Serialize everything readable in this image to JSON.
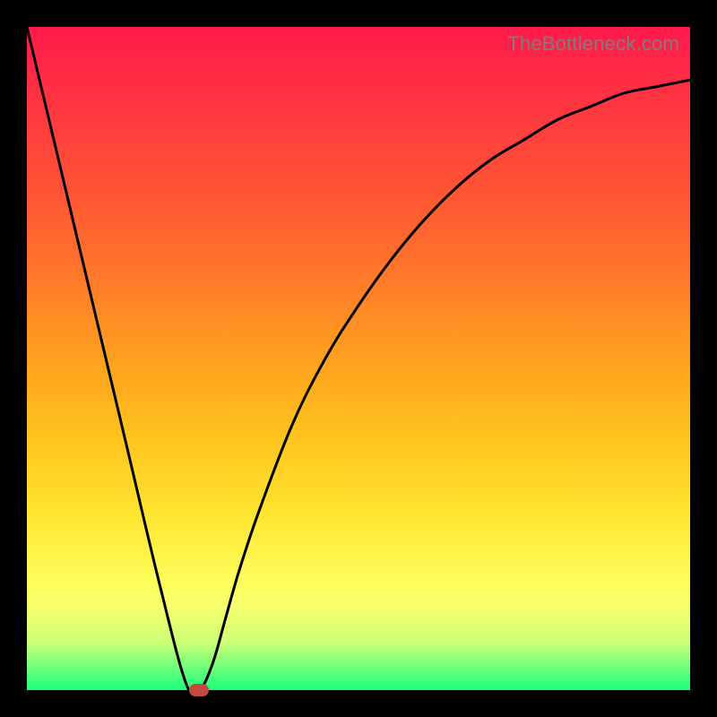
{
  "watermark": "TheBottleneck.com",
  "chart_data": {
    "type": "line",
    "title": "",
    "xlabel": "",
    "ylabel": "",
    "xlim": [
      0,
      100
    ],
    "ylim": [
      0,
      100
    ],
    "grid": false,
    "legend": false,
    "background": "red-yellow-green vertical gradient (high=red, low=green)",
    "series": [
      {
        "name": "bottleneck-curve",
        "x": [
          0,
          5,
          10,
          15,
          20,
          24,
          26,
          28,
          30,
          32,
          35,
          40,
          45,
          50,
          55,
          60,
          65,
          70,
          75,
          80,
          85,
          90,
          95,
          100
        ],
        "values": [
          100,
          79,
          58,
          37,
          16,
          1,
          0,
          4,
          11,
          18,
          27,
          40,
          50,
          58,
          65,
          71,
          76,
          80,
          83,
          86,
          88,
          90,
          91,
          92
        ]
      }
    ],
    "marker": {
      "x": 26,
      "y": 0,
      "shape": "rounded-rect",
      "color": "#c24a3f"
    }
  }
}
